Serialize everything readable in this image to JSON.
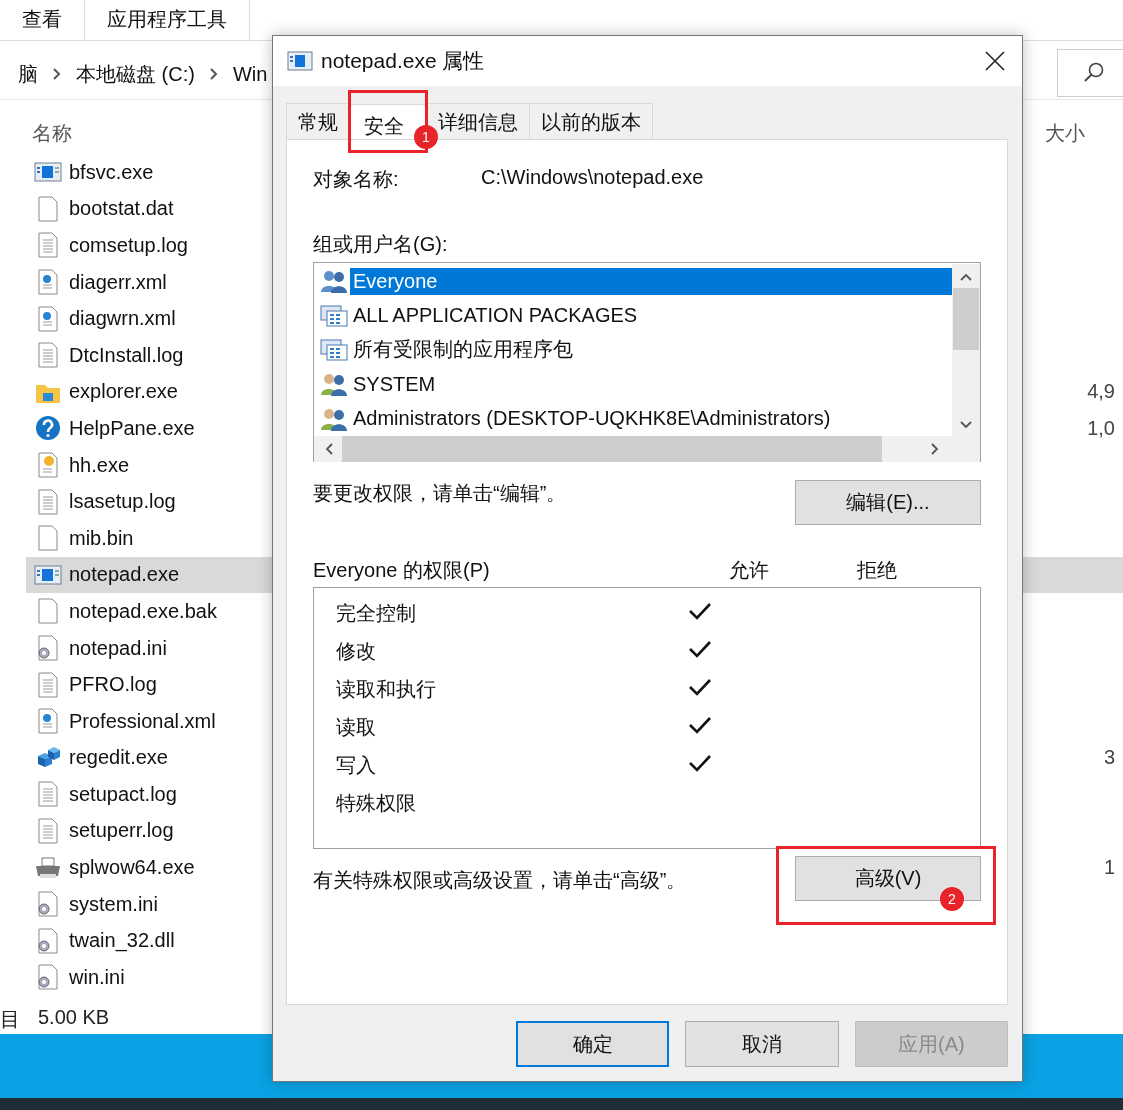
{
  "explorer": {
    "ribbon_tabs": [
      "查看",
      "应用程序工具"
    ],
    "breadcrumb": [
      "脑",
      "本地磁盘 (C:)",
      "Win"
    ],
    "columns": {
      "name": "名称",
      "size": "大小"
    },
    "files": [
      {
        "name": "bfsvc.exe",
        "kind": "exe",
        "selected": false
      },
      {
        "name": "bootstat.dat",
        "kind": "blank",
        "selected": false
      },
      {
        "name": "comsetup.log",
        "kind": "text",
        "selected": false
      },
      {
        "name": "diagerr.xml",
        "kind": "xml",
        "selected": false
      },
      {
        "name": "diagwrn.xml",
        "kind": "xml",
        "selected": false
      },
      {
        "name": "DtcInstall.log",
        "kind": "text",
        "selected": false
      },
      {
        "name": "explorer.exe",
        "kind": "folder",
        "selected": false,
        "size": "4,9"
      },
      {
        "name": "HelpPane.exe",
        "kind": "help",
        "selected": false,
        "size": "1,0"
      },
      {
        "name": "hh.exe",
        "kind": "hh",
        "selected": false
      },
      {
        "name": "lsasetup.log",
        "kind": "text",
        "selected": false
      },
      {
        "name": "mib.bin",
        "kind": "blank",
        "selected": false
      },
      {
        "name": "notepad.exe",
        "kind": "exe",
        "selected": true
      },
      {
        "name": "notepad.exe.bak",
        "kind": "blank",
        "selected": false
      },
      {
        "name": "notepad.ini",
        "kind": "ini",
        "selected": false
      },
      {
        "name": "PFRO.log",
        "kind": "text",
        "selected": false
      },
      {
        "name": "Professional.xml",
        "kind": "xml",
        "selected": false
      },
      {
        "name": "regedit.exe",
        "kind": "regedit",
        "selected": false,
        "size": "3"
      },
      {
        "name": "setupact.log",
        "kind": "text",
        "selected": false
      },
      {
        "name": "setuperr.log",
        "kind": "text",
        "selected": false
      },
      {
        "name": "splwow64.exe",
        "kind": "printer",
        "selected": false,
        "size": "1"
      },
      {
        "name": "system.ini",
        "kind": "ini",
        "selected": false
      },
      {
        "name": "twain_32.dll",
        "kind": "dll",
        "selected": false
      },
      {
        "name": "win.ini",
        "kind": "ini",
        "selected": false
      }
    ],
    "status_bar": {
      "items": "目",
      "size": "5.00 KB"
    }
  },
  "dialog": {
    "title": "notepad.exe 属性",
    "tabs": [
      {
        "label": "常规",
        "selected": false
      },
      {
        "label": "安全",
        "selected": true,
        "marker": "1"
      },
      {
        "label": "详细信息",
        "selected": false
      },
      {
        "label": "以前的版本",
        "selected": false
      }
    ],
    "object_label": "对象名称:",
    "object_value": "C:\\Windows\\notepad.exe",
    "groups_label": "组或用户名(G):",
    "principals": [
      {
        "name": "Everyone",
        "kind": "group",
        "selected": true
      },
      {
        "name": "ALL APPLICATION PACKAGES",
        "kind": "package",
        "selected": false
      },
      {
        "name": "所有受限制的应用程序包",
        "kind": "package",
        "selected": false
      },
      {
        "name": "SYSTEM",
        "kind": "user-group",
        "selected": false
      },
      {
        "name": "Administrators (DESKTOP-UQKHK8E\\Administrators)",
        "kind": "user-group",
        "selected": false
      }
    ],
    "edit_hint": "要更改权限，请单击“编辑”。",
    "edit_button": "编辑(E)...",
    "permissions_title": "Everyone 的权限(P)",
    "allow_header": "允许",
    "deny_header": "拒绝",
    "permissions": [
      {
        "name": "完全控制",
        "allow": true,
        "deny": false
      },
      {
        "name": "修改",
        "allow": true,
        "deny": false
      },
      {
        "name": "读取和执行",
        "allow": true,
        "deny": false
      },
      {
        "name": "读取",
        "allow": true,
        "deny": false
      },
      {
        "name": "写入",
        "allow": true,
        "deny": false
      },
      {
        "name": "特殊权限",
        "allow": false,
        "deny": false
      }
    ],
    "advanced_hint": "有关特殊权限或高级设置，请单击“高级”。",
    "advanced_button": "高级(V)",
    "advanced_marker": "2",
    "buttons": [
      {
        "label": "确定",
        "default": true,
        "disabled": false
      },
      {
        "label": "取消",
        "default": false,
        "disabled": false
      },
      {
        "label": "应用(A)",
        "default": false,
        "disabled": true
      }
    ]
  }
}
